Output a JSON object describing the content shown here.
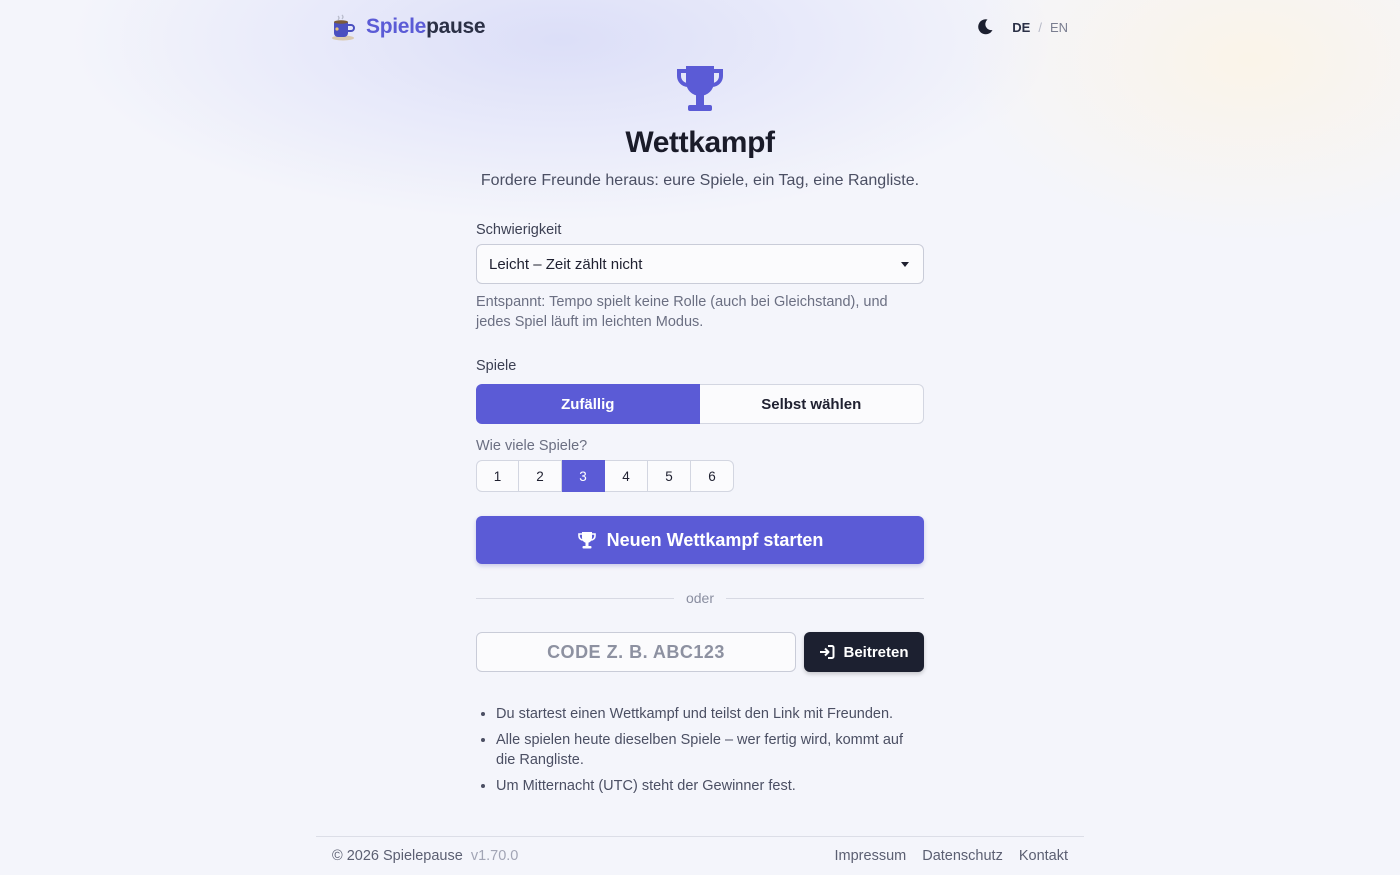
{
  "header": {
    "brand_part1": "Spiele",
    "brand_part2": "pause",
    "lang_active": "DE",
    "lang_separator": "/",
    "lang_other": "EN"
  },
  "hero": {
    "title": "Wettkampf",
    "subtitle": "Fordere Freunde heraus: eure Spiele, ein Tag, eine Rangliste."
  },
  "difficulty": {
    "label": "Schwierigkeit",
    "selected": "Leicht – Zeit zählt nicht",
    "hint": "Entspannt: Tempo spielt keine Rolle (auch bei Gleichstand), und jedes Spiel läuft im leichten Modus."
  },
  "games": {
    "label": "Spiele",
    "mode_random": "Zufällig",
    "mode_choose": "Selbst wählen",
    "count_label": "Wie viele Spiele?",
    "counts": [
      "1",
      "2",
      "3",
      "4",
      "5",
      "6"
    ],
    "selected_count": "3"
  },
  "start_button": "Neuen Wettkampf starten",
  "divider_text": "oder",
  "join": {
    "placeholder": "CODE Z. B. ABC123",
    "value": "",
    "button": "Beitreten"
  },
  "info": [
    "Du startest einen Wettkampf und teilst den Link mit Freunden.",
    "Alle spielen heute dieselben Spiele – wer fertig wird, kommt auf die Rangliste.",
    "Um Mitternacht (UTC) steht der Gewinner fest."
  ],
  "footer": {
    "copyright": "© 2026 Spielepause",
    "version": "v1.70.0",
    "links": [
      "Impressum",
      "Datenschutz",
      "Kontakt"
    ]
  },
  "colors": {
    "accent": "#5b5bd6",
    "dark_button": "#1c2030",
    "background": "#f4f5fb"
  },
  "icons": {
    "logo": "coffee-mug-icon",
    "theme": "moon-icon",
    "hero": "trophy-icon",
    "start": "trophy-icon",
    "join": "sign-in-icon"
  }
}
